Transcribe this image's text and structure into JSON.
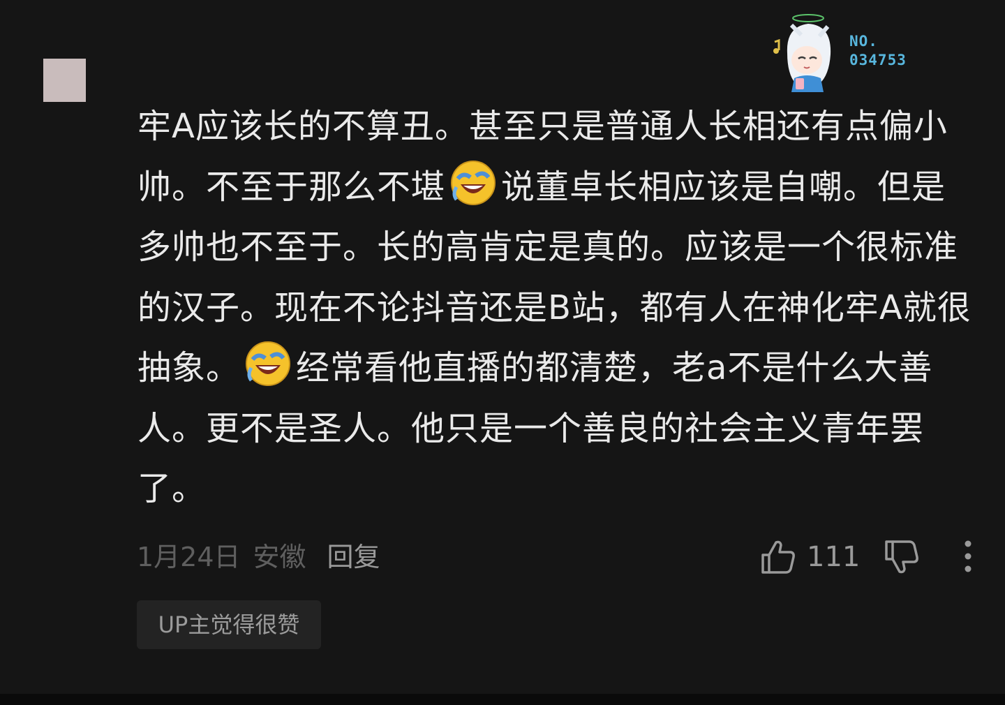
{
  "comment": {
    "segments": [
      {
        "type": "text",
        "value": "牢A应该长的不算丑。甚至只是普通人长相还有点偏小帅。不至于那么不堪"
      },
      {
        "type": "emoji",
        "name": "laughing-cry-emoji"
      },
      {
        "type": "text",
        "value": "说董卓长相应该是自嘲。但是多帅也不至于。长的高肯定是真的。应该是一个很标准的汉子。现在不论抖音还是B站，都有人在神化牢A就很抽象。"
      },
      {
        "type": "emoji",
        "name": "laughing-cry-emoji"
      },
      {
        "type": "text",
        "value": "经常看他直播的都清楚，老a不是什么大善人。更不是圣人。他只是一个善良的社会主义青年罢了。"
      }
    ]
  },
  "badge": {
    "line1": "NO.",
    "line2": "034753"
  },
  "meta": {
    "date": "1月24日",
    "location": "安徽",
    "reply_label": "回复"
  },
  "actions": {
    "like_count": "111"
  },
  "up_tag": "UP主觉得很赞",
  "colors": {
    "background": "#151515",
    "text": "#eaeaea",
    "muted": "#5f5f5f",
    "badge_accent": "#58b6dd"
  }
}
